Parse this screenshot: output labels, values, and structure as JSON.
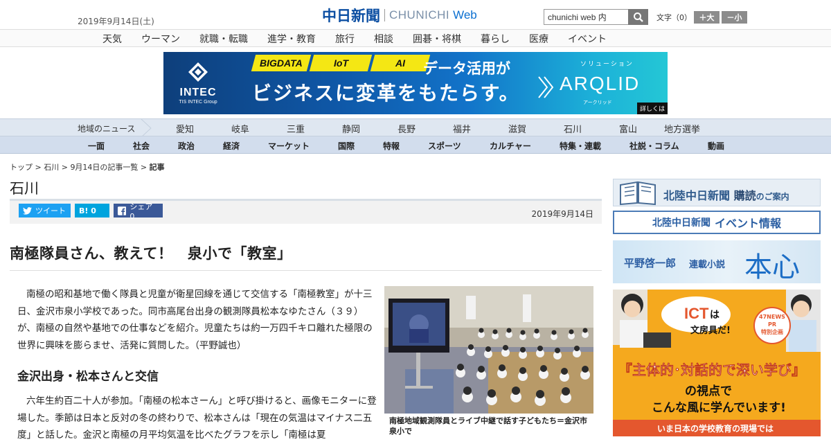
{
  "header": {
    "date": "2019年9月14日(土)",
    "logo_jp": "中日新聞",
    "logo_en": "CHUNICHI",
    "logo_web": "Web",
    "search_value": "chunichi web 内",
    "moji_label": "文字（0）",
    "bigger_label": "＋大",
    "smaller_label": "－小"
  },
  "catnav": [
    "天気",
    "ウーマン",
    "就職・転職",
    "進学・教育",
    "旅行",
    "相談",
    "囲碁・将棋",
    "暮らし",
    "医療",
    "イベント"
  ],
  "banner": {
    "tags": [
      "BIGDATA",
      "IoT",
      "AI"
    ],
    "line1": "データ活用が",
    "line2": "ビジネスに変革をもたらす。",
    "company": "INTEC",
    "company_sub": "TIS INTEC Group",
    "solution": "ソリューション",
    "product": "ARQLID",
    "product_kana": "アークリッド",
    "details": "詳しくは"
  },
  "regionnav": {
    "label": "地域のニュース",
    "items": [
      "愛知",
      "岐阜",
      "三重",
      "静岡",
      "長野",
      "福井",
      "滋賀",
      "石川",
      "富山",
      "地方選挙"
    ]
  },
  "genrenav": [
    "一面",
    "社会",
    "政治",
    "経済",
    "マーケット",
    "国際",
    "特報",
    "スポーツ",
    "カルチャー",
    "特集・連載",
    "社説・コラム",
    "動画"
  ],
  "breadcrumb": {
    "top": "トップ",
    "sep": " > ",
    "region": "石川",
    "list": "9月14日の記事一覧",
    "current": "記事"
  },
  "section": "石川",
  "share": {
    "tweet": "ツイート",
    "hatena": "B! 0",
    "facebook": "シェア 0"
  },
  "pubdate": "2019年9月14日",
  "article": {
    "headline": "南極隊員さん、教えて！　泉小で「教室」",
    "lead": "南極の昭和基地で働く隊員と児童が衛星回線を通じて交信する「南極教室」が十三日、金沢市泉小学校であった。同市高尾台出身の観測隊員松本なゆたさん（３９）が、南極の自然や基地での仕事などを紹介。児童たちは約一万四千キロ離れた極限の世界に興味を膨らませ、活発に質問した。（平野誠也）",
    "subhead": "金沢出身・松本さんと交信",
    "body": "六年生約百二十人が参加。「南極の松本さーん」と呼び掛けると、画像モニターに登場した。季節は日本と反対の冬の終わりで、松本さんは「現在の気温はマイナス二五度」と話した。金沢と南極の月平均気温を比べたグラフを示し「南極は夏",
    "caption": "南極地域観測隊員とライブ中継で話す子どもたち＝金沢市泉小で"
  },
  "side": {
    "subscribe_1": "北陸中日新聞",
    "subscribe_2": "購読",
    "subscribe_3": "のご案内",
    "event_1": "北陸中日新聞",
    "event_2": "イベント情報",
    "novel_author": "平野啓一郎",
    "novel_label": "連載小説",
    "novel_title": "本心",
    "ict_title": "ICT",
    "ict_sub1": "は",
    "ict_sub2": "文房具だ!",
    "ict_badge_1": "47NEWS",
    "ict_badge_2": "PR",
    "ict_badge_3": "特別企画",
    "ict_quote": "『主体的･対話的で深い学び』",
    "ict_line2": "の視点で",
    "ict_line3": "こんな風に学んでいます!",
    "ict_line4": "いま日本の学校教育の現場では"
  },
  "colors": {
    "brand_blue": "#0b4ea2",
    "twitter": "#1da1f2",
    "hatena": "#00a4de",
    "facebook": "#3b5998",
    "ict_orange": "#f5a91e"
  }
}
